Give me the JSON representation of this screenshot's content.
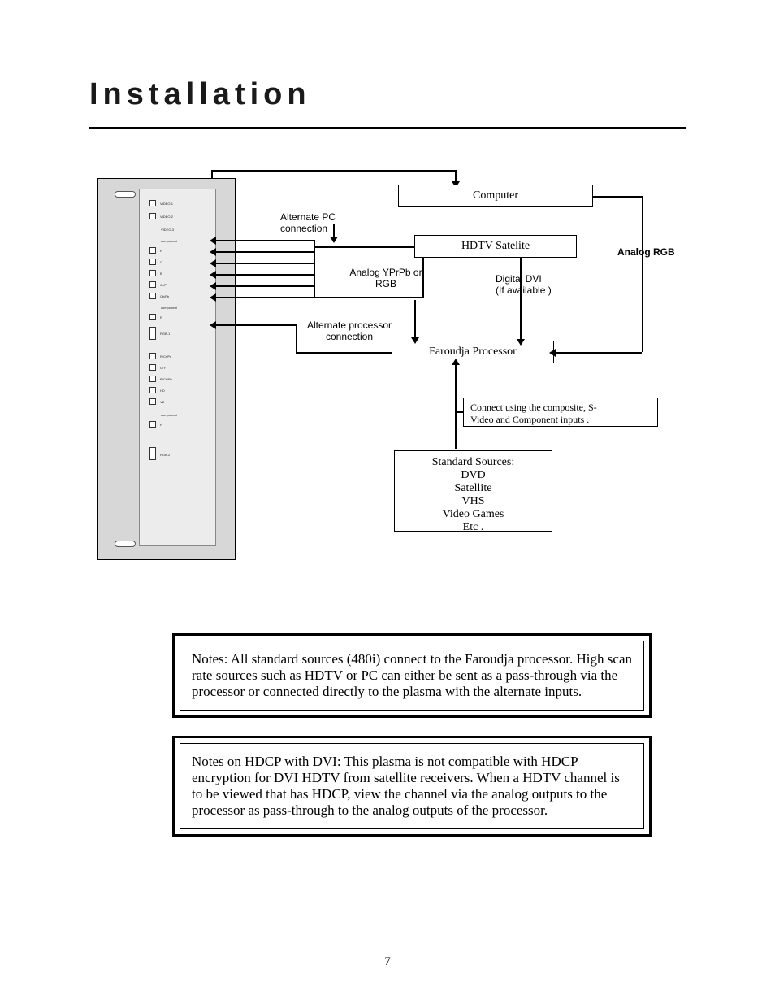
{
  "title": "Installation",
  "page_number": "7",
  "panel_ports": [
    {
      "label": "VIDEO-1"
    },
    {
      "label": "VIDEO-2"
    },
    {
      "label": "VIDEO-3"
    },
    {
      "label": "component"
    },
    {
      "label": "R"
    },
    {
      "label": "G"
    },
    {
      "label": "B"
    },
    {
      "label": "Cr/Pr"
    },
    {
      "label": "Cb/Pb"
    },
    {
      "label": "component"
    },
    {
      "label": "R"
    },
    {
      "label": "RGB-1"
    },
    {
      "label": "R/Cr/Pr"
    },
    {
      "label": "G/Y"
    },
    {
      "label": "B/Cb/Pb"
    },
    {
      "label": "HD"
    },
    {
      "label": "VD"
    },
    {
      "label": "component"
    },
    {
      "label": "R"
    },
    {
      "label": "RGB-2"
    }
  ],
  "diagram": {
    "computer": "Computer",
    "hdtv": "HDTV  Satelite",
    "faroudja": "Faroudja Processor",
    "sources_heading": "Standard Sources:",
    "sources_lines": [
      "DVD",
      "Satellite",
      "VHS",
      "Video   Games",
      "Etc ."
    ],
    "alt_pc": "Alternate PC connection",
    "alt_proc1": "Alternate processor",
    "alt_proc2": "connection",
    "yprpb1": "Analog YPrPb or",
    "yprpb2": "RGB",
    "digital_dvi1": "Digital DVI",
    "digital_dvi2": "(If available )",
    "analog_rgb": "Analog RGB",
    "connect_note1": "Connect using the composite, S-",
    "connect_note2": "Video and Component inputs    ."
  },
  "notes1": "Notes: All standard sources (480i) connect to the Faroudja processor. High scan rate sources such as HDTV or PC can either be sent as a pass-through via the processor or connected directly to the plasma with the alternate inputs.",
  "notes2": "Notes on HDCP with DVI: This plasma is not compatible with HDCP encryption for DVI HDTV from satellite receivers.  When a HDTV channel is to be viewed that has HDCP, view the channel via the analog outputs to the processor as pass-through to the analog outputs of the processor.",
  "chart_data": {
    "type": "diagram",
    "nodes": [
      {
        "id": "panel",
        "label": "Plasma rear panel (inputs)"
      },
      {
        "id": "computer",
        "label": "Computer"
      },
      {
        "id": "hdtv",
        "label": "HDTV Satelite"
      },
      {
        "id": "faroudja",
        "label": "Faroudja Processor"
      },
      {
        "id": "sources",
        "label": "Standard Sources: DVD, Satellite, VHS, Video Games, Etc."
      }
    ],
    "edges": [
      {
        "from": "computer",
        "to": "panel",
        "label": "Alternate PC connection"
      },
      {
        "from": "computer",
        "to": "faroudja",
        "label": "Analog RGB"
      },
      {
        "from": "hdtv",
        "to": "panel",
        "label": "Analog YPrPb or RGB"
      },
      {
        "from": "hdtv",
        "to": "faroudja",
        "label": "Digital DVI (If available)"
      },
      {
        "from": "faroudja",
        "to": "panel",
        "label": "Alternate processor connection"
      },
      {
        "from": "sources",
        "to": "faroudja",
        "label": "Connect using the composite, S-Video and Component inputs."
      }
    ]
  }
}
